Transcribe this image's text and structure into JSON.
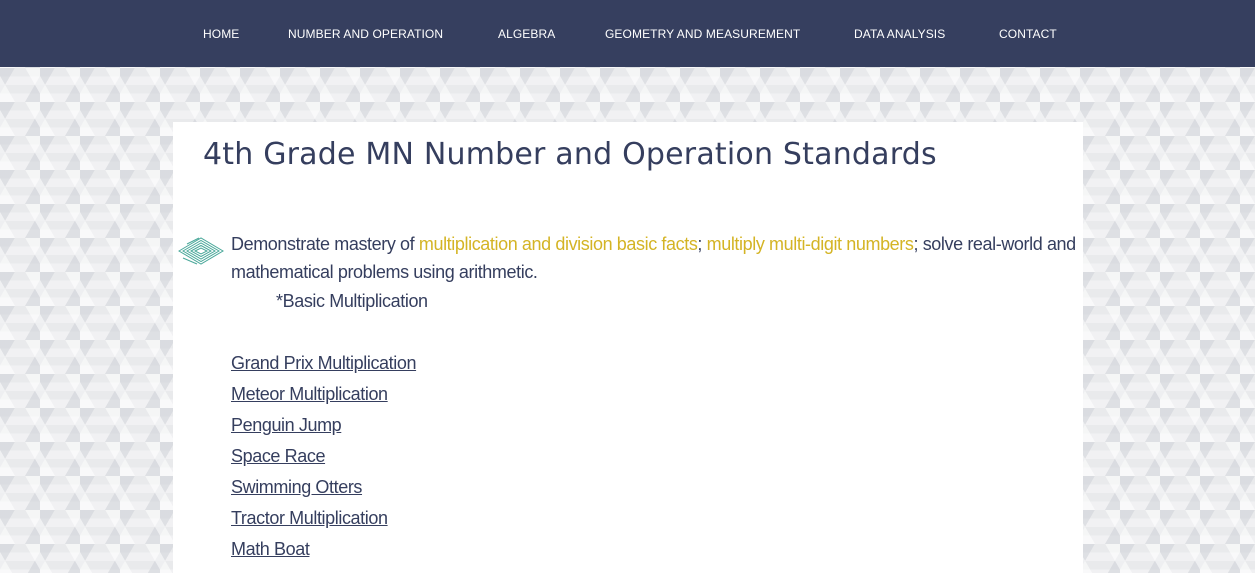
{
  "nav": {
    "items": [
      {
        "label": "HOME"
      },
      {
        "label": "NUMBER AND OPERATION"
      },
      {
        "label": "ALGEBRA"
      },
      {
        "label": "GEOMETRY AND MEASUREMENT"
      },
      {
        "label": "DATA ANALYSIS"
      },
      {
        "label": "CONTACT"
      }
    ]
  },
  "main": {
    "title": "4th Grade MN Number and Operation Standards",
    "standard": {
      "part1": "Demonstrate mastery of ",
      "highlight1": "multiplication and division basic facts",
      "part2": "; ",
      "highlight2": "multiply multi-digit numbers",
      "part3": "; solve real-world and mathematical problems using arithmetic."
    },
    "subheading": "*Basic Multiplication",
    "links": [
      {
        "label": "Grand Prix Multiplication"
      },
      {
        "label": "Meteor Multiplication"
      },
      {
        "label": "Penguin Jump"
      },
      {
        "label": "Space Race"
      },
      {
        "label": "Swimming Otters"
      },
      {
        "label": "Tractor Multiplication"
      },
      {
        "label": "Math Boat"
      }
    ]
  },
  "colors": {
    "navbar": "#363f5f",
    "text": "#353e5e",
    "highlight": "#d4b425",
    "icon": "#4aa89a"
  },
  "icons": {
    "bullet": "diamond-bullet-icon"
  }
}
